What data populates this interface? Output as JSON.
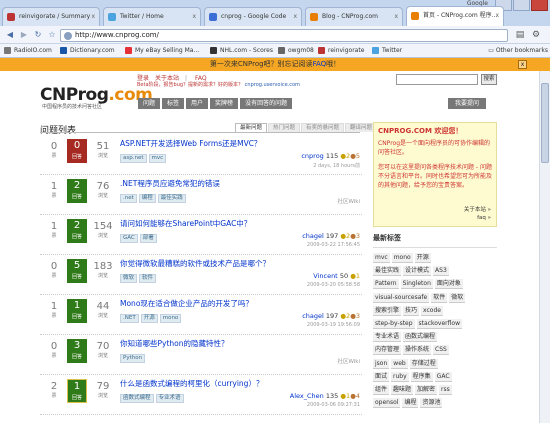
{
  "browser": {
    "google_label": "Google",
    "tabs": [
      {
        "label": "reinvigorate / Summary",
        "fav": "#b33"
      },
      {
        "label": "Twitter / Home",
        "fav": "#4aa3df"
      },
      {
        "label": "cnprog - Google Code",
        "fav": "#3b6fd6"
      },
      {
        "label": "Blog - CNProg.com",
        "fav": "#e87e04"
      },
      {
        "label": "首页 - CNProg.com 程序...",
        "fav": "#e87e04"
      }
    ],
    "url": "http://www.cnprog.com/",
    "bookmarks": [
      {
        "label": "RadioIO.com",
        "color": "#777"
      },
      {
        "label": "Dictionary.com",
        "color": "#1a56a8"
      },
      {
        "label": "My eBay Selling Ma...",
        "color": "#e53238"
      },
      {
        "label": "NHL.com - Scores",
        "color": "#333"
      },
      {
        "label": "owgm08",
        "color": "#666"
      },
      {
        "label": "reinvigorate",
        "color": "#b33"
      },
      {
        "label": "Twitter",
        "color": "#4aa3df"
      }
    ],
    "other_bookmarks": "Other bookmarks"
  },
  "notice": {
    "text_before": "第一次来CNProg吧？别忘记阅读",
    "link": "FAQ",
    "text_after": "哦！",
    "close": "x"
  },
  "header": {
    "logo_main": "CNProg",
    "logo_dot": ".com",
    "logo_sub": "中国程序员的技术问答社区",
    "login": "登录",
    "about": "关于本站",
    "sep": "|",
    "faq": "FAQ",
    "beta_text": "Beta阶段，报告bug？提新的需求？好的版本？",
    "beta_link": "cnprog.uservoice.com",
    "search_button": "搜索",
    "nav": [
      "问题",
      "标签",
      "用户",
      "奖牌榜",
      "没有回答的问题"
    ],
    "ask": "我要提问"
  },
  "list": {
    "title": "问题列表",
    "tabs": [
      "最新问题",
      "热门问题",
      "有奖的悬问题",
      "翻译问题"
    ],
    "labels": {
      "votes": "票",
      "answers": "回答",
      "views": "浏览"
    },
    "questions": [
      {
        "votes": "0",
        "answers": "0",
        "views": "51",
        "title": "ASP.NET开发选择Web Forms还是MVC？",
        "tags": [
          "asp.net",
          "mvc"
        ],
        "user": "cnprog",
        "rep": "115",
        "gold": "●2",
        "bronze": "●5",
        "date": "2 days, 18 hours前"
      },
      {
        "votes": "1",
        "answers": "2",
        "views": "76",
        "title": ".NET程序员应避免常犯的错误",
        "tags": [
          ".net",
          "编程",
          "最佳实践"
        ],
        "user": "",
        "rep": "",
        "gold": "",
        "bronze": "",
        "date": "",
        "wiki": "社区Wiki"
      },
      {
        "votes": "1",
        "answers": "2",
        "views": "154",
        "title": "请问如何能够在SharePoint中GAC中？",
        "tags": [
          "GAC",
          "部署"
        ],
        "user": "chagel",
        "rep": "197",
        "gold": "●2",
        "bronze": "●3",
        "date": "2009-03-22 17:56:45"
      },
      {
        "votes": "0",
        "answers": "5",
        "views": "183",
        "title": "你觉得微软最糟糕的软件或技术产品是哪个？",
        "tags": [
          "微软",
          "软件"
        ],
        "user": "Vincent",
        "rep": "50",
        "gold": "●1",
        "bronze": "",
        "date": "2009-03-20 05:58:58"
      },
      {
        "votes": "1",
        "answers": "1",
        "views": "44",
        "title": "Mono现在适合做企业产品的开发了吗？",
        "tags": [
          ".NET",
          "开源",
          "mono"
        ],
        "user": "chagel",
        "rep": "197",
        "gold": "●2",
        "bronze": "●3",
        "date": "2009-03-19 19:56:09"
      },
      {
        "votes": "0",
        "answers": "3",
        "views": "70",
        "title": "你知道哪些Python的隐藏特性？",
        "tags": [
          "Python"
        ],
        "user": "",
        "rep": "",
        "gold": "",
        "bronze": "",
        "date": "",
        "wiki": "社区Wiki"
      },
      {
        "votes": "2",
        "answers": "1",
        "views": "79",
        "title": "什么是函数式编程的柯里化（currying）？",
        "tags": [
          "函数式编程",
          "专业术语"
        ],
        "user": "Alex_Chen",
        "rep": "135",
        "gold": "●1",
        "bronze": "●4",
        "date": "2009-03-06 09:27:31"
      }
    ]
  },
  "sidebar": {
    "welcome_title": "CNPROG.COM 欢迎您！",
    "welcome_text": "CNProg是一个面向程序员的可协作编辑的问答社区。",
    "welcome_text2": "您可以在这里提问各类程序技术问题 - 问题不分语言和平台。同时也希望您可为所能及的其他问题，给予您的宝贵答案。",
    "about_link": "关于本站 »",
    "faq_link": "faq »",
    "tags_title": "最新标签",
    "tag_rows": [
      [
        "mvc",
        "mono",
        "开源"
      ],
      [
        "最佳实践",
        "设计模式",
        "AS3"
      ],
      [
        "Pattern",
        "Singleton",
        "面向对象"
      ],
      [
        "visual-sourcesafe",
        "软件",
        "微软"
      ],
      [
        "搜索引擎",
        "技巧",
        "xcode"
      ],
      [
        "step-by-step",
        "stackoverflow"
      ],
      [
        "专业术语",
        "函数式编程"
      ],
      [
        "内存管理",
        "操作系统",
        "CSS"
      ],
      [
        "json",
        "web",
        "存储过程"
      ],
      [
        "面试",
        "ruby",
        "程序集",
        "GAC"
      ],
      [
        "组件",
        "趣味题",
        "加解密",
        "rss"
      ],
      [
        "opensol",
        "编程",
        "资源池"
      ]
    ]
  }
}
